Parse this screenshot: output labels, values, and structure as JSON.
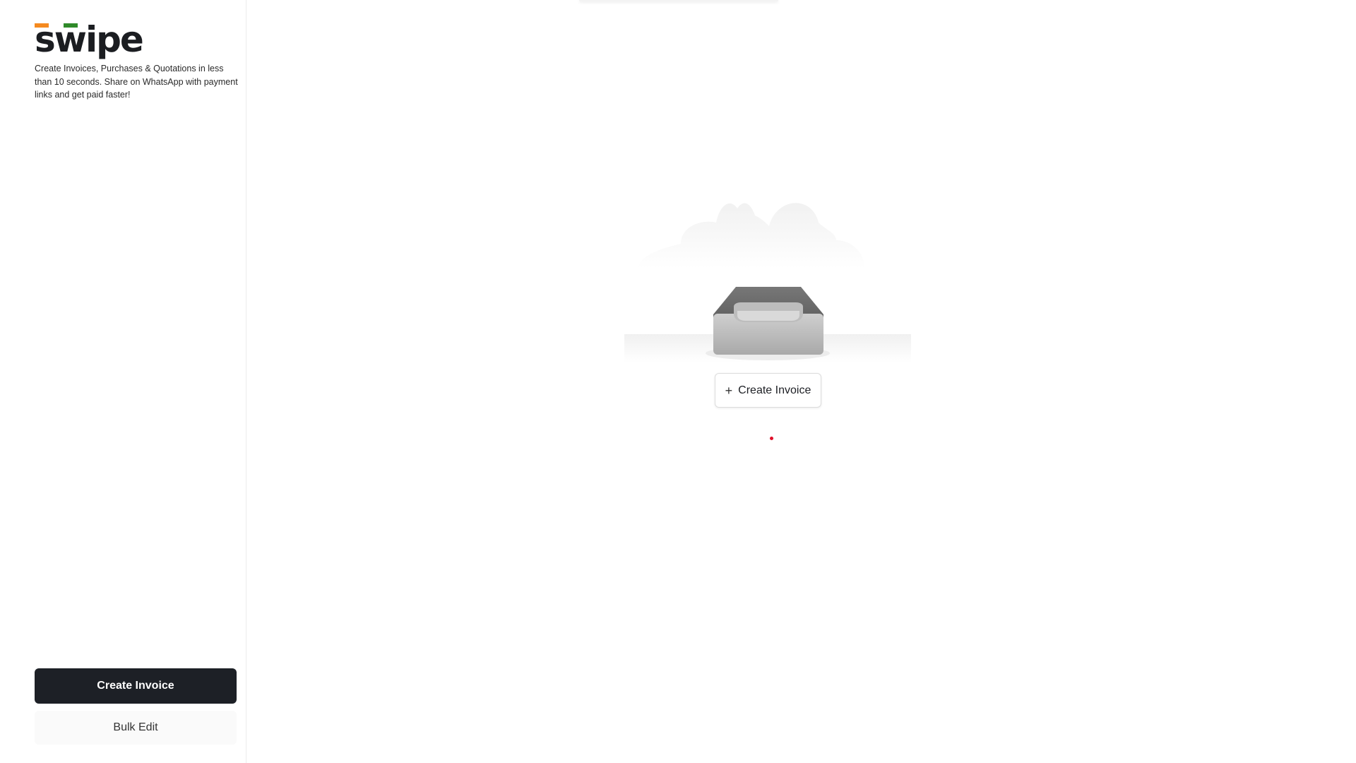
{
  "brand": {
    "name": "swipe",
    "accent_orange": "#f58a1f",
    "accent_green": "#2f8a2a"
  },
  "sidebar": {
    "tagline": "Create Invoices, Purchases & Quotations in less than 10 seconds. Share on WhatsApp with payment links and get paid faster!",
    "primary_button": "Create Invoice",
    "secondary_button": "Bulk Edit"
  },
  "main": {
    "empty_state": {
      "illustration": "empty-inbox-tray",
      "create_button": "Create Invoice",
      "create_icon": "plus-icon"
    }
  },
  "colors": {
    "primary_button_bg": "#1d2026",
    "indicator_dot": "#e0102a"
  }
}
